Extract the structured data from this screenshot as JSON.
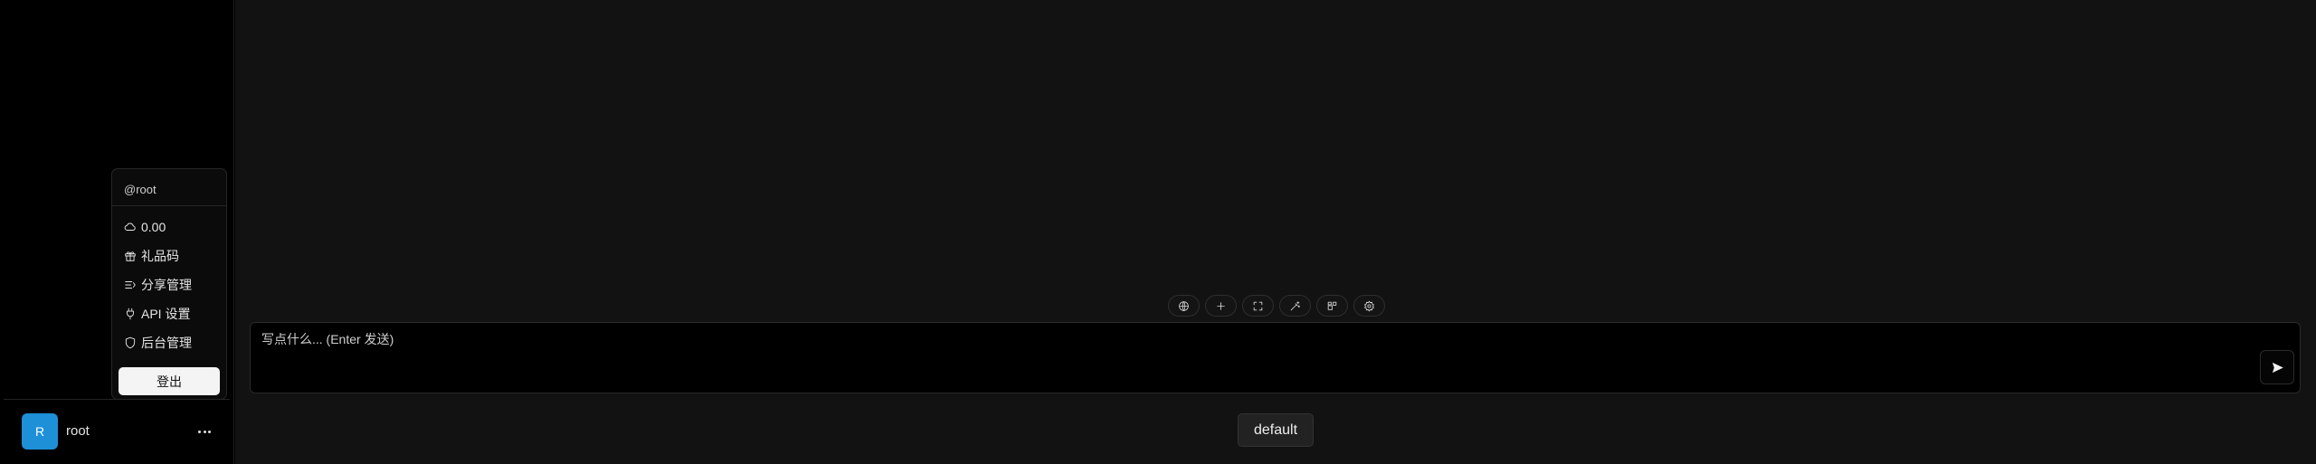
{
  "sidebar": {
    "user": {
      "avatar_letter": "R",
      "name": "root",
      "avatar_color": "#1e90d8"
    }
  },
  "user_menu": {
    "handle": "@root",
    "items": [
      {
        "label": "0.00",
        "icon": "cloud-icon"
      },
      {
        "label": "礼品码",
        "icon": "gift-icon"
      },
      {
        "label": "分享管理",
        "icon": "share-list-icon"
      },
      {
        "label": "API 设置",
        "icon": "plug-icon"
      },
      {
        "label": "后台管理",
        "icon": "shield-icon"
      }
    ],
    "logout_label": "登出"
  },
  "toolbar": {
    "buttons": [
      "globe-icon",
      "plus-icon",
      "fullscreen-icon",
      "magic-wand-icon",
      "plugins-icon",
      "settings-icon"
    ]
  },
  "composer": {
    "placeholder": "写点什么... (Enter 发送)",
    "send_icon": "send-icon"
  },
  "model_selector": {
    "label": "default"
  }
}
